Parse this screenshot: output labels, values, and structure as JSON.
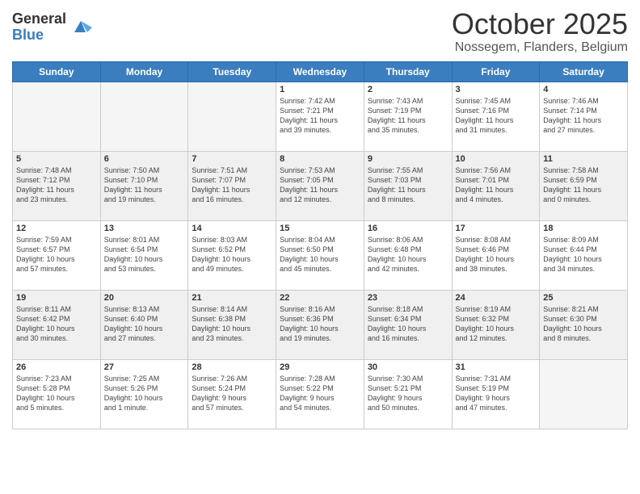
{
  "logo": {
    "general": "General",
    "blue": "Blue"
  },
  "header": {
    "title": "October 2025",
    "subtitle": "Nossegem, Flanders, Belgium"
  },
  "weekdays": [
    "Sunday",
    "Monday",
    "Tuesday",
    "Wednesday",
    "Thursday",
    "Friday",
    "Saturday"
  ],
  "weeks": [
    [
      {
        "day": "",
        "info": "",
        "empty": true
      },
      {
        "day": "",
        "info": "",
        "empty": true
      },
      {
        "day": "",
        "info": "",
        "empty": true
      },
      {
        "day": "1",
        "info": "Sunrise: 7:42 AM\nSunset: 7:21 PM\nDaylight: 11 hours\nand 39 minutes."
      },
      {
        "day": "2",
        "info": "Sunrise: 7:43 AM\nSunset: 7:19 PM\nDaylight: 11 hours\nand 35 minutes."
      },
      {
        "day": "3",
        "info": "Sunrise: 7:45 AM\nSunset: 7:16 PM\nDaylight: 11 hours\nand 31 minutes."
      },
      {
        "day": "4",
        "info": "Sunrise: 7:46 AM\nSunset: 7:14 PM\nDaylight: 11 hours\nand 27 minutes."
      }
    ],
    [
      {
        "day": "5",
        "info": "Sunrise: 7:48 AM\nSunset: 7:12 PM\nDaylight: 11 hours\nand 23 minutes."
      },
      {
        "day": "6",
        "info": "Sunrise: 7:50 AM\nSunset: 7:10 PM\nDaylight: 11 hours\nand 19 minutes."
      },
      {
        "day": "7",
        "info": "Sunrise: 7:51 AM\nSunset: 7:07 PM\nDaylight: 11 hours\nand 16 minutes."
      },
      {
        "day": "8",
        "info": "Sunrise: 7:53 AM\nSunset: 7:05 PM\nDaylight: 11 hours\nand 12 minutes."
      },
      {
        "day": "9",
        "info": "Sunrise: 7:55 AM\nSunset: 7:03 PM\nDaylight: 11 hours\nand 8 minutes."
      },
      {
        "day": "10",
        "info": "Sunrise: 7:56 AM\nSunset: 7:01 PM\nDaylight: 11 hours\nand 4 minutes."
      },
      {
        "day": "11",
        "info": "Sunrise: 7:58 AM\nSunset: 6:59 PM\nDaylight: 11 hours\nand 0 minutes."
      }
    ],
    [
      {
        "day": "12",
        "info": "Sunrise: 7:59 AM\nSunset: 6:57 PM\nDaylight: 10 hours\nand 57 minutes."
      },
      {
        "day": "13",
        "info": "Sunrise: 8:01 AM\nSunset: 6:54 PM\nDaylight: 10 hours\nand 53 minutes."
      },
      {
        "day": "14",
        "info": "Sunrise: 8:03 AM\nSunset: 6:52 PM\nDaylight: 10 hours\nand 49 minutes."
      },
      {
        "day": "15",
        "info": "Sunrise: 8:04 AM\nSunset: 6:50 PM\nDaylight: 10 hours\nand 45 minutes."
      },
      {
        "day": "16",
        "info": "Sunrise: 8:06 AM\nSunset: 6:48 PM\nDaylight: 10 hours\nand 42 minutes."
      },
      {
        "day": "17",
        "info": "Sunrise: 8:08 AM\nSunset: 6:46 PM\nDaylight: 10 hours\nand 38 minutes."
      },
      {
        "day": "18",
        "info": "Sunrise: 8:09 AM\nSunset: 6:44 PM\nDaylight: 10 hours\nand 34 minutes."
      }
    ],
    [
      {
        "day": "19",
        "info": "Sunrise: 8:11 AM\nSunset: 6:42 PM\nDaylight: 10 hours\nand 30 minutes."
      },
      {
        "day": "20",
        "info": "Sunrise: 8:13 AM\nSunset: 6:40 PM\nDaylight: 10 hours\nand 27 minutes."
      },
      {
        "day": "21",
        "info": "Sunrise: 8:14 AM\nSunset: 6:38 PM\nDaylight: 10 hours\nand 23 minutes."
      },
      {
        "day": "22",
        "info": "Sunrise: 8:16 AM\nSunset: 6:36 PM\nDaylight: 10 hours\nand 19 minutes."
      },
      {
        "day": "23",
        "info": "Sunrise: 8:18 AM\nSunset: 6:34 PM\nDaylight: 10 hours\nand 16 minutes."
      },
      {
        "day": "24",
        "info": "Sunrise: 8:19 AM\nSunset: 6:32 PM\nDaylight: 10 hours\nand 12 minutes."
      },
      {
        "day": "25",
        "info": "Sunrise: 8:21 AM\nSunset: 6:30 PM\nDaylight: 10 hours\nand 8 minutes."
      }
    ],
    [
      {
        "day": "26",
        "info": "Sunrise: 7:23 AM\nSunset: 5:28 PM\nDaylight: 10 hours\nand 5 minutes."
      },
      {
        "day": "27",
        "info": "Sunrise: 7:25 AM\nSunset: 5:26 PM\nDaylight: 10 hours\nand 1 minute."
      },
      {
        "day": "28",
        "info": "Sunrise: 7:26 AM\nSunset: 5:24 PM\nDaylight: 9 hours\nand 57 minutes."
      },
      {
        "day": "29",
        "info": "Sunrise: 7:28 AM\nSunset: 5:22 PM\nDaylight: 9 hours\nand 54 minutes."
      },
      {
        "day": "30",
        "info": "Sunrise: 7:30 AM\nSunset: 5:21 PM\nDaylight: 9 hours\nand 50 minutes."
      },
      {
        "day": "31",
        "info": "Sunrise: 7:31 AM\nSunset: 5:19 PM\nDaylight: 9 hours\nand 47 minutes."
      },
      {
        "day": "",
        "info": "",
        "empty": true
      }
    ]
  ]
}
